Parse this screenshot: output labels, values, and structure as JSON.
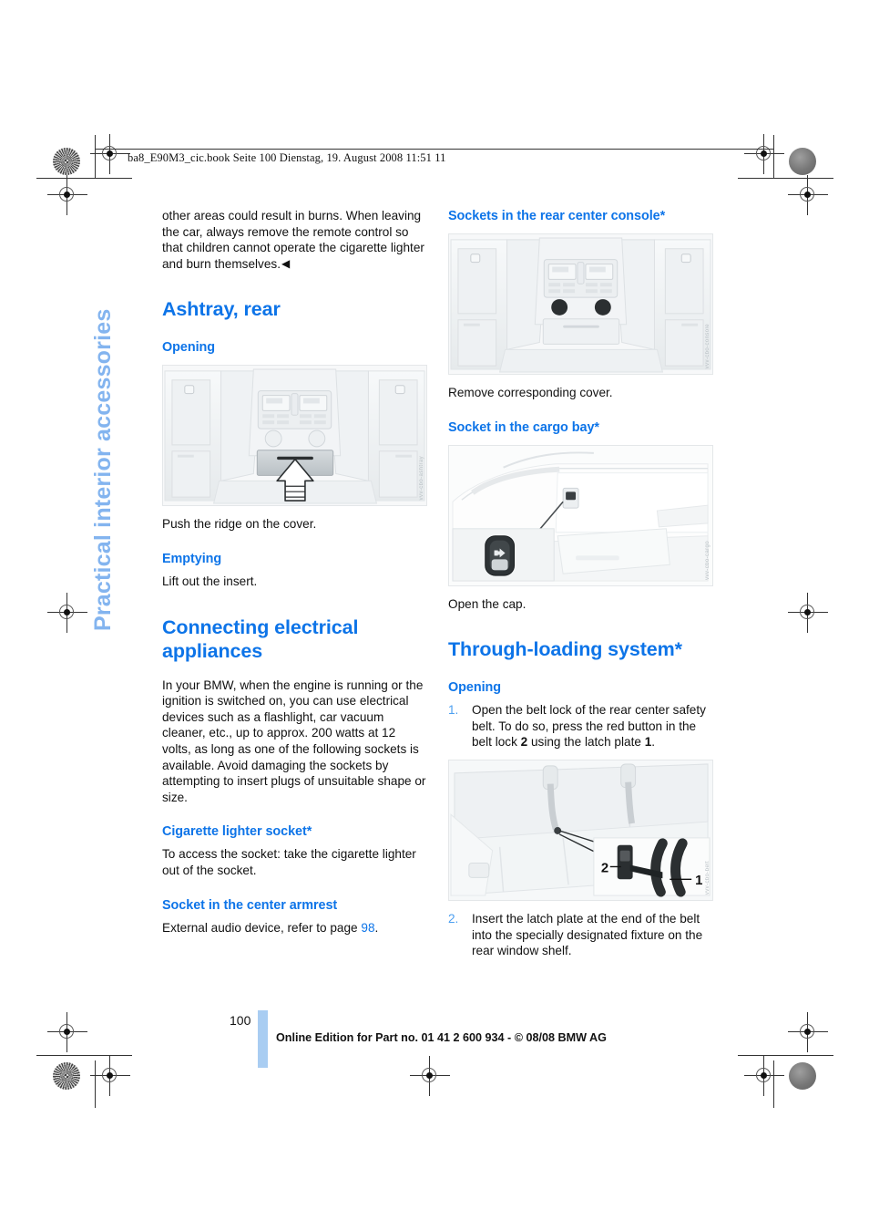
{
  "document": {
    "book_header": "ba8_E90M3_cic.book  Seite 100  Dienstag, 19. August 2008  11:51 11",
    "side_tab": "Practical interior accessories",
    "page_number": "100",
    "footer": "Online Edition for Part no. 01 41 2 600 934 - © 08/08 BMW AG",
    "accent_color": "#0d74e8",
    "side_tab_color": "#83b4ef",
    "folio_bar_color": "#a9cdf2"
  },
  "left_column": {
    "intro_paragraph": "other areas could result in burns. When leaving the car, always remove the remote control so that children cannot operate the cigarette lighter and burn themselves.",
    "intro_endmark": "◀",
    "ashtray": {
      "heading": "Ashtray, rear",
      "opening_heading": "Opening",
      "figure_caption": "Push the ridge on the cover.",
      "figure_watermark": "vvv-cbo-ashtray",
      "emptying_heading": "Emptying",
      "emptying_text": "Lift out the insert."
    },
    "connecting": {
      "heading": "Connecting electrical appliances",
      "paragraph": "In your BMW, when the engine is running or the ignition is switched on, you can use electrical devices such as a flashlight, car vacuum cleaner, etc., up to approx. 200 watts at 12 volts, as long as one of the following sockets is available. Avoid damaging the sockets by attempting to insert plugs of unsuitable shape or size.",
      "cigarette_heading": "Cigarette lighter socket*",
      "cigarette_text": "To access the socket: take the cigarette lighter out of the socket.",
      "armrest_heading": "Socket in the center armrest",
      "armrest_text_before": "External audio device, refer to page ",
      "armrest_page_ref": "98",
      "armrest_text_after": "."
    }
  },
  "right_column": {
    "rear_console": {
      "heading": "Sockets in the rear center console*",
      "figure_watermark": "vvv-cbo-console",
      "caption": "Remove corresponding cover."
    },
    "cargo_bay": {
      "heading": "Socket in the cargo bay*",
      "figure_watermark": "vvv-cbo-cargo",
      "caption": "Open the cap."
    },
    "through_loading": {
      "heading": "Through-loading system*",
      "opening_heading": "Opening",
      "steps": [
        {
          "num": "1.",
          "parts": [
            {
              "t": "Open the belt lock of the rear center safety belt. To do so, press the red button in the belt lock ",
              "b": false
            },
            {
              "t": "2",
              "b": true
            },
            {
              "t": " using the latch plate ",
              "b": false
            },
            {
              "t": "1",
              "b": true
            },
            {
              "t": ".",
              "b": false
            }
          ]
        },
        {
          "num": "2.",
          "parts": [
            {
              "t": "Insert the latch plate at the end of the belt into the specially designated fixture on the rear window shelf.",
              "b": false
            }
          ]
        }
      ],
      "figure_watermark": "vvv-cbo-belt",
      "figure_labels": {
        "one": "1",
        "two": "2"
      }
    }
  }
}
